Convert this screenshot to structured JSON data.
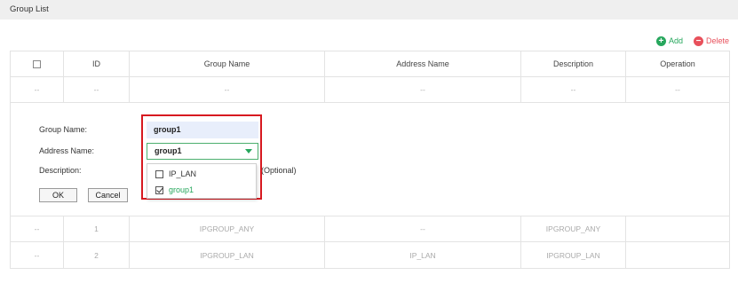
{
  "header": {
    "title": "Group List"
  },
  "toolbar": {
    "add_label": "Add",
    "delete_label": "Delete",
    "add_icon": "plus-circle-icon",
    "delete_icon": "minus-circle-icon"
  },
  "table": {
    "columns": [
      "ID",
      "Group Name",
      "Address Name",
      "Description",
      "Operation"
    ],
    "new_row": [
      "--",
      "--",
      "--",
      "--",
      "--",
      "--"
    ],
    "rows": [
      [
        "--",
        "1",
        "IPGROUP_ANY",
        "--",
        "IPGROUP_ANY",
        ""
      ],
      [
        "--",
        "2",
        "IPGROUP_LAN",
        "IP_LAN",
        "IPGROUP_LAN",
        ""
      ]
    ]
  },
  "form": {
    "group_name_label": "Group Name:",
    "group_name_value": "group1",
    "address_name_label": "Address Name:",
    "address_name_value": "group1",
    "description_label": "Description:",
    "description_hint": "(Optional)",
    "ok_label": "OK",
    "cancel_label": "Cancel",
    "dropdown_options": [
      {
        "label": "IP_LAN",
        "checked": false
      },
      {
        "label": "group1",
        "checked": true
      }
    ]
  },
  "colors": {
    "accent_green": "#27a75d",
    "delete_red": "#e8505b",
    "highlight_red": "#d71920"
  }
}
